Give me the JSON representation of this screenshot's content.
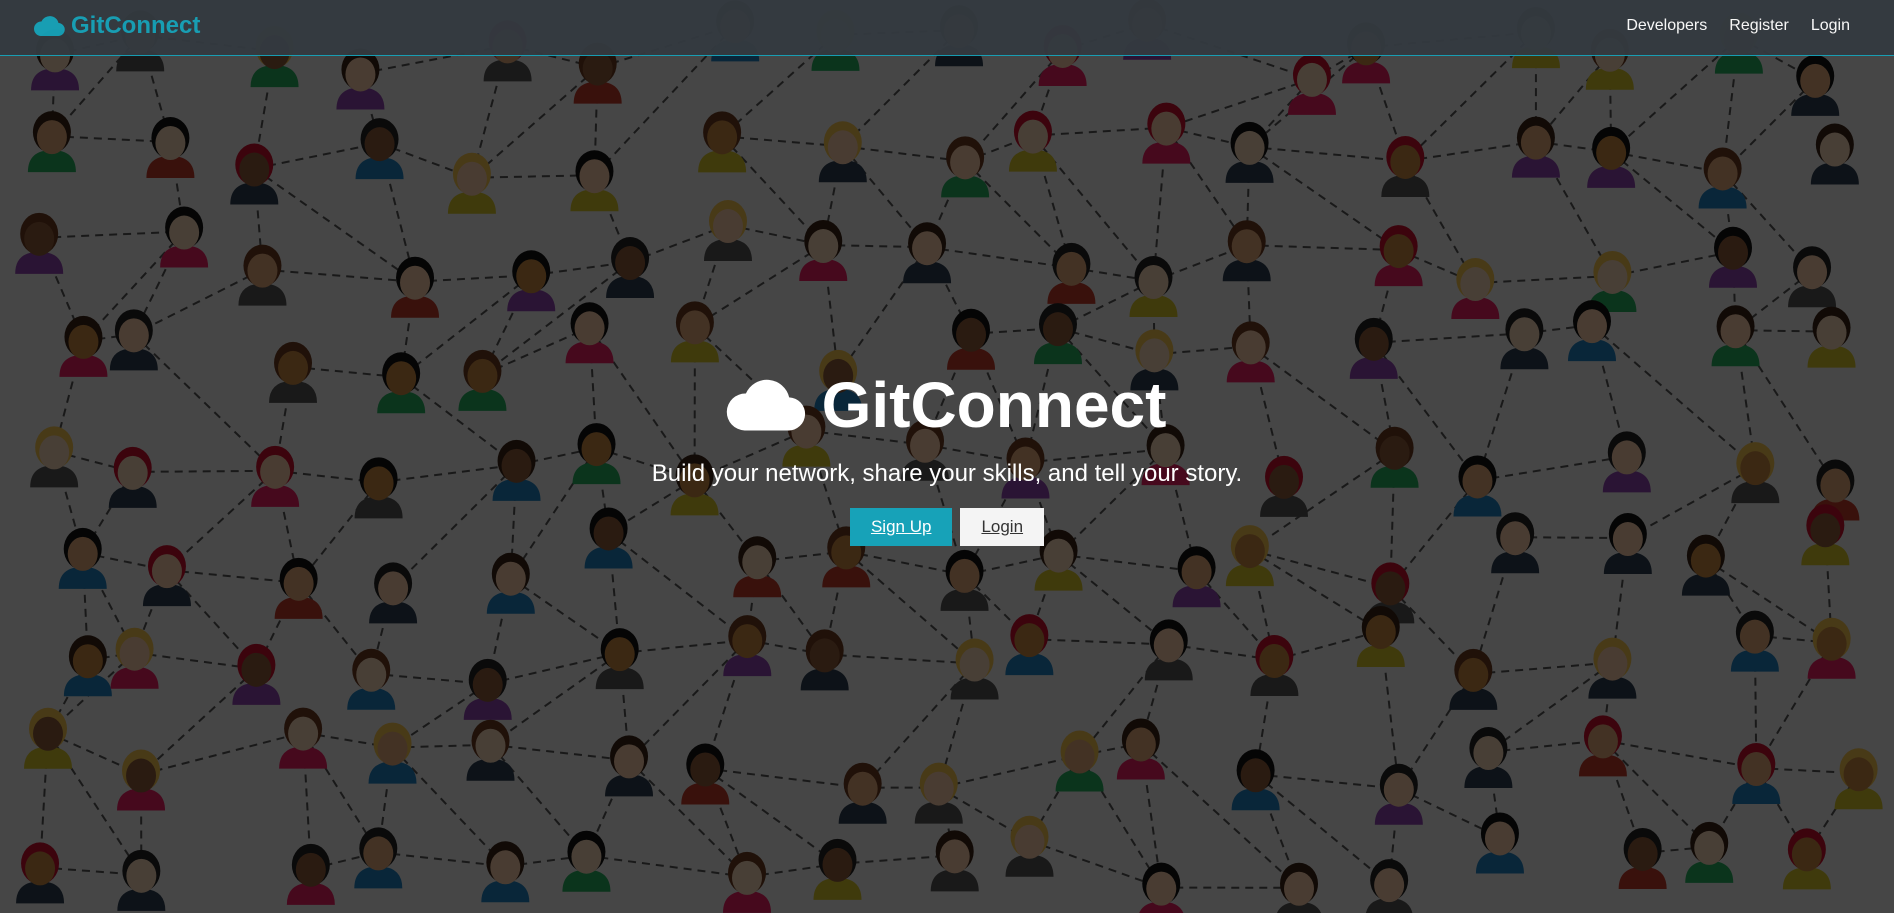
{
  "brand": {
    "name": "GitConnect",
    "icon": "cloud-icon",
    "color": "#17a2b8"
  },
  "nav": {
    "links": [
      {
        "label": "Developers"
      },
      {
        "label": "Register"
      },
      {
        "label": "Login"
      }
    ]
  },
  "landing": {
    "title": "GitConnect",
    "title_icon": "cloud-icon",
    "lead": "Build your network, share your skills, and tell your story.",
    "signup_label": "Sign Up",
    "login_label": "Login"
  },
  "colors": {
    "primary": "#17a2b8",
    "navbar": "#343a40",
    "light": "#f4f4f4"
  }
}
